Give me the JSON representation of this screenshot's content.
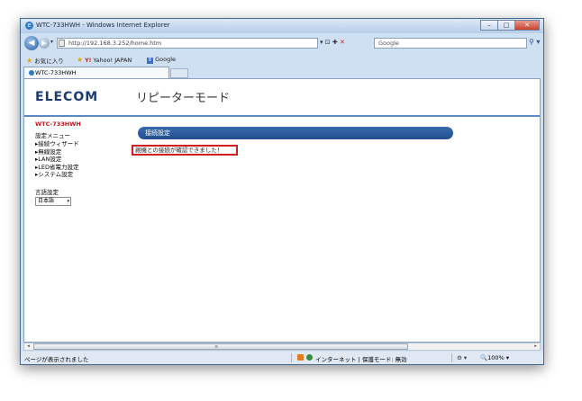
{
  "window": {
    "title": "WTC-733HWH - Windows Internet Explorer",
    "minimize": "–",
    "maximize": "□",
    "close": "✕"
  },
  "addressbar": {
    "url": "http://192.168.3.252/home.htm",
    "search_placeholder": "Google",
    "back_glyph": "◀",
    "forward_glyph": "▶",
    "dropdown_glyph": "▾",
    "tools": "▾ ⊡ ✚",
    "stop_glyph": "✕",
    "search_glyph": "⚲ ▾"
  },
  "favorites": {
    "favorites_label": "お気に入り",
    "yahoo_label": "Yahoo! JAPAN",
    "google_label": "Google"
  },
  "tabs": {
    "active_label": "WTC-733HWH"
  },
  "page": {
    "logo": "ELECOM",
    "mode_title": "リピーターモード",
    "sidebar": {
      "model": "WTC-733HWH",
      "menu_heading": "設定メニュー",
      "items": [
        {
          "label": "▸接続ウィザード"
        },
        {
          "label": "▸無線設定"
        },
        {
          "label": "▸LAN設定"
        },
        {
          "label": "▸LED省電力設定"
        },
        {
          "label": "▸システム設定"
        }
      ],
      "language_heading": "言語設定",
      "language_value": "日本語",
      "language_arrow": "▾"
    },
    "section_title": "接続設定",
    "message": "親機との接続が確認できました！"
  },
  "scrollbar": {
    "left": "◂",
    "right": "▸",
    "grip": "≡"
  },
  "statusbar": {
    "status": "ページが表示されました",
    "zone": "インターネット | 保護モード: 無効",
    "zoom_tools": "⚙ ▾",
    "zoom": "🔍100%  ▾"
  }
}
